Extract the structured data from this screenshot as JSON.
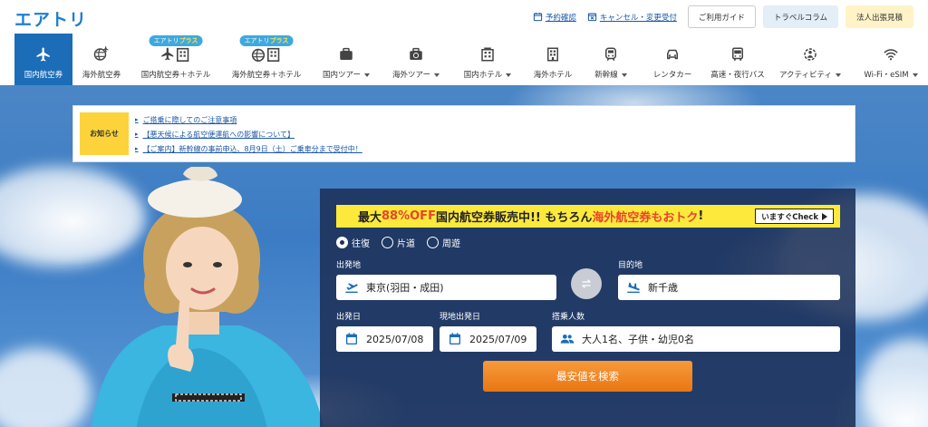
{
  "header": {
    "logo": "エアトリ",
    "links": [
      {
        "label": "予約確認",
        "icon": "calendar-icon"
      },
      {
        "label": "キャンセル・変更受付",
        "icon": "calendar-x-icon"
      }
    ],
    "buttons": [
      "ご利用ガイド",
      "トラベルコラム",
      "法人出張見積"
    ]
  },
  "nav": {
    "active": "国内航空券",
    "items": [
      {
        "label": "国内航空券",
        "icon": "plane-icon",
        "dropdown": false,
        "badge": ""
      },
      {
        "label": "海外航空券",
        "icon": "globe-plane-icon",
        "dropdown": false,
        "badge": ""
      },
      {
        "label": "国内航空券＋ホテル",
        "icon": "plane-hotel-icon",
        "dropdown": false,
        "badge": "エアトリプラス"
      },
      {
        "label": "海外航空券＋ホテル",
        "icon": "globe-hotel-icon",
        "dropdown": false,
        "badge": "エアトリプラス"
      },
      {
        "label": "国内ツアー",
        "icon": "suitcase-icon",
        "dropdown": true,
        "badge": ""
      },
      {
        "label": "海外ツアー",
        "icon": "suitcase-globe-icon",
        "dropdown": true,
        "badge": ""
      },
      {
        "label": "国内ホテル",
        "icon": "hotel-icon",
        "dropdown": true,
        "badge": ""
      },
      {
        "label": "海外ホテル",
        "icon": "building-icon",
        "dropdown": false,
        "badge": ""
      },
      {
        "label": "新幹線",
        "icon": "train-icon",
        "dropdown": true,
        "badge": ""
      },
      {
        "label": "レンタカー",
        "icon": "car-icon",
        "dropdown": false,
        "badge": ""
      },
      {
        "label": "高速・夜行バス",
        "icon": "bus-icon",
        "dropdown": false,
        "badge": ""
      },
      {
        "label": "アクティビティ",
        "icon": "activity-icon",
        "dropdown": true,
        "badge": ""
      },
      {
        "label": "Wi-Fi・eSIM",
        "icon": "wifi-icon",
        "dropdown": true,
        "badge": ""
      }
    ]
  },
  "notice": {
    "label": "お知らせ",
    "items": [
      "ご搭乗に際してのご注意事項",
      "【悪天候による航空便運航への影響について】",
      "【ご案内】新幹線の事前申込、8月9日（土）ご乗車分まで受付中！"
    ]
  },
  "promo": {
    "part1": "最大",
    "part2": "88%OFF",
    "part3": " 国内航空券販売中!! もちろん",
    "part4": "海外航空券もおトク",
    "part5": "!",
    "check": "いますぐCheck"
  },
  "search": {
    "trip_types": [
      {
        "label": "往復",
        "checked": true
      },
      {
        "label": "片道",
        "checked": false
      },
      {
        "label": "周遊",
        "checked": false
      }
    ],
    "origin_label": "出発地",
    "origin_value": "東京(羽田・成田)",
    "destination_label": "目的地",
    "destination_value": "新千歳",
    "depart_label": "出発日",
    "depart_value": "2025/07/08",
    "return_label": "現地出発日",
    "return_value": "2025/07/09",
    "passengers_label": "搭乗人数",
    "passengers_value": "大人1名、子供・幼児0名",
    "submit": "最安値を検索"
  },
  "colors": {
    "brand": "#1e7fd0",
    "nav_active": "#1c6db8",
    "notice_label": "#fcd33a",
    "promo_bg": "#fce93c",
    "promo_red": "#e9432c",
    "panel_bg": "#1c3058",
    "search_button": "#f08a24"
  }
}
